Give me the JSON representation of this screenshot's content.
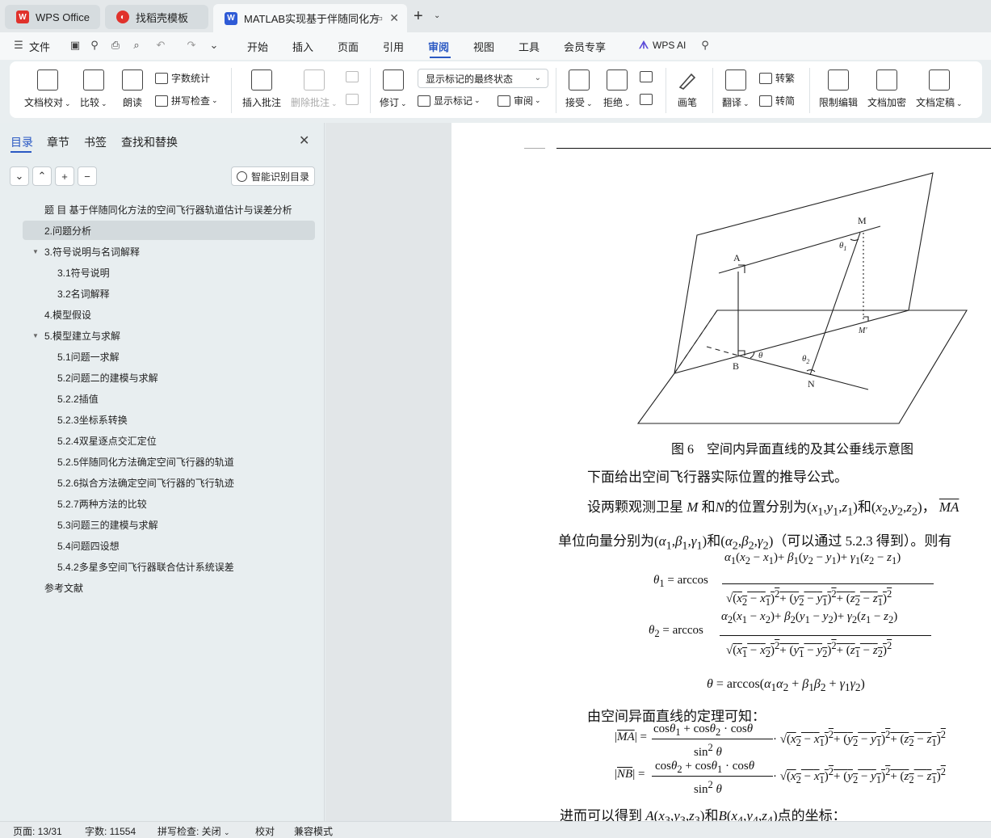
{
  "tabs": [
    {
      "label": "WPS Office",
      "icon": "wps-logo-icon"
    },
    {
      "label": "找稻壳模板",
      "icon": "docer-icon"
    },
    {
      "label": "MATLAB实现基于伴随同化方",
      "icon": "word-doc-icon"
    }
  ],
  "menu": {
    "file": "文件",
    "items": [
      "开始",
      "插入",
      "页面",
      "引用",
      "审阅",
      "视图",
      "工具",
      "会员专享"
    ],
    "active": "审阅",
    "wps_ai": "WPS AI"
  },
  "ribbon": {
    "doc_proof": "文档校对",
    "compare": "比较",
    "read_aloud": "朗读",
    "word_count": "字数统计",
    "spell_check": "拼写检查",
    "insert_comment": "插入批注",
    "delete_comment": "删除批注",
    "revise": "修订",
    "markup_state": "显示标记的最终状态",
    "show_markup": "显示标记",
    "review": "审阅",
    "accept": "接受",
    "reject": "拒绝",
    "pen": "画笔",
    "translate": "翻译",
    "to_traditional": "转繁",
    "to_simplified": "转简",
    "restrict_edit": "限制编辑",
    "doc_encrypt": "文档加密",
    "doc_finalize": "文档定稿"
  },
  "nav": {
    "tabs": [
      "目录",
      "章节",
      "书签",
      "查找和替换"
    ],
    "smart_toc": "智能识别目录",
    "toc": [
      {
        "text": "题 目 基于伴随同化方法的空间飞行器轨道估计与误差分析",
        "level": 0
      },
      {
        "text": "2.问题分析",
        "level": 0,
        "selected": true
      },
      {
        "text": "3.符号说明与名词解释",
        "level": 0,
        "expanded": true
      },
      {
        "text": "3.1符号说明",
        "level": 1
      },
      {
        "text": "3.2名词解释",
        "level": 1
      },
      {
        "text": "4.模型假设",
        "level": 0
      },
      {
        "text": "5.模型建立与求解",
        "level": 0,
        "expanded": true
      },
      {
        "text": "5.1问题一求解",
        "level": 1
      },
      {
        "text": "5.2问题二的建模与求解",
        "level": 1
      },
      {
        "text": "5.2.2插值",
        "level": 1
      },
      {
        "text": "5.2.3坐标系转换",
        "level": 1
      },
      {
        "text": "5.2.4双星逐点交汇定位",
        "level": 1
      },
      {
        "text": "5.2.5伴随同化方法确定空间飞行器的轨道",
        "level": 1
      },
      {
        "text": "5.2.6拟合方法确定空间飞行器的飞行轨迹",
        "level": 1
      },
      {
        "text": "5.2.7两种方法的比较",
        "level": 1
      },
      {
        "text": "5.3问题三的建模与求解",
        "level": 1
      },
      {
        "text": "5.4问题四设想",
        "level": 1
      },
      {
        "text": "5.4.2多星多空间飞行器联合估计系统误差",
        "level": 1
      },
      {
        "text": "参考文献",
        "level": 0
      }
    ]
  },
  "doc": {
    "figure_labels": {
      "A": "A",
      "M": "M",
      "M_prime": "M'",
      "B": "B",
      "N": "N",
      "theta": "θ",
      "theta1": "θ",
      "theta1_sub": "1",
      "theta2": "θ",
      "theta2_sub": "2"
    },
    "caption": "图 6　空间内异面直线的及其公垂线示意图",
    "para1": "下面给出空间飞行器实际位置的推导公式。",
    "para2_a": "设两颗观测卫星",
    "para2_b": "和",
    "para2_c": "的位置分别为",
    "para3_a": "单位向量分别为",
    "para3_b": "（可以通过  5.2.3 得到）。则有",
    "para4": "由空间异面直线的定理可知：",
    "para5_a": "进而可以得到",
    "para5_b": "点的坐标："
  },
  "status": {
    "page": "页面: 13/31",
    "words": "字数: 11554",
    "spell": "拼写检查: 关闭",
    "proof": "校对",
    "compat": "兼容模式"
  },
  "colors": {
    "accent": "#2b59c3",
    "wps_red": "#e0322c",
    "word_blue": "#2f5bd6"
  }
}
